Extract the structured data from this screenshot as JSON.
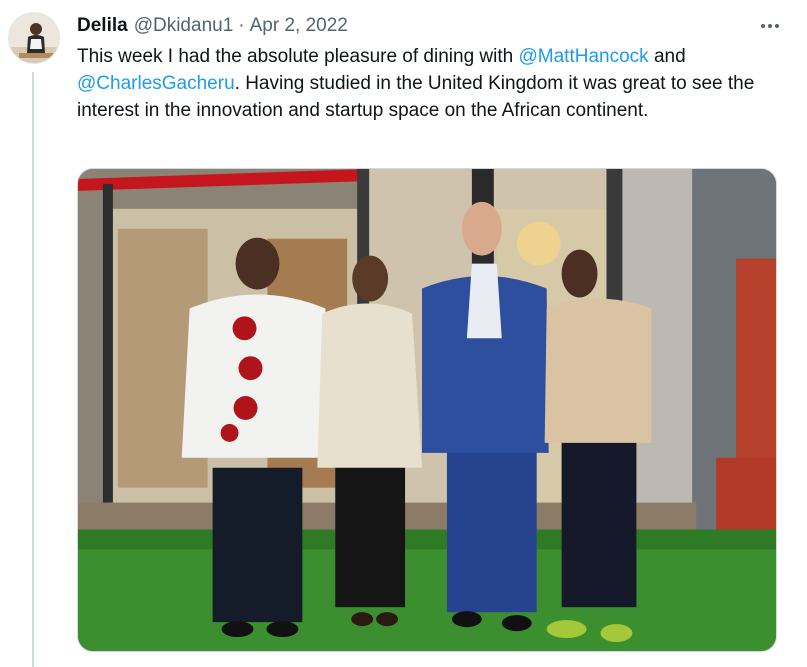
{
  "tweet": {
    "author_name": "Delila",
    "author_handle": "@Dkidanu1",
    "separator": "·",
    "date": "Apr 2, 2022",
    "text_part1": "This week I had the absolute pleasure of dining with ",
    "mention1": "@MattHancock",
    "text_part2": " and ",
    "mention2": "@CharlesGacheru",
    "text_part3": ". Having studied in the United Kingdom it was great to see the interest in the innovation and startup space on the African continent.",
    "more_icon": "more-horizontal-icon",
    "photo_alt": "Image"
  },
  "colors": {
    "link": "#1d9bf0",
    "secondary_text": "#536471",
    "primary_text": "#0f1419",
    "thread_line": "#cfd9de"
  }
}
